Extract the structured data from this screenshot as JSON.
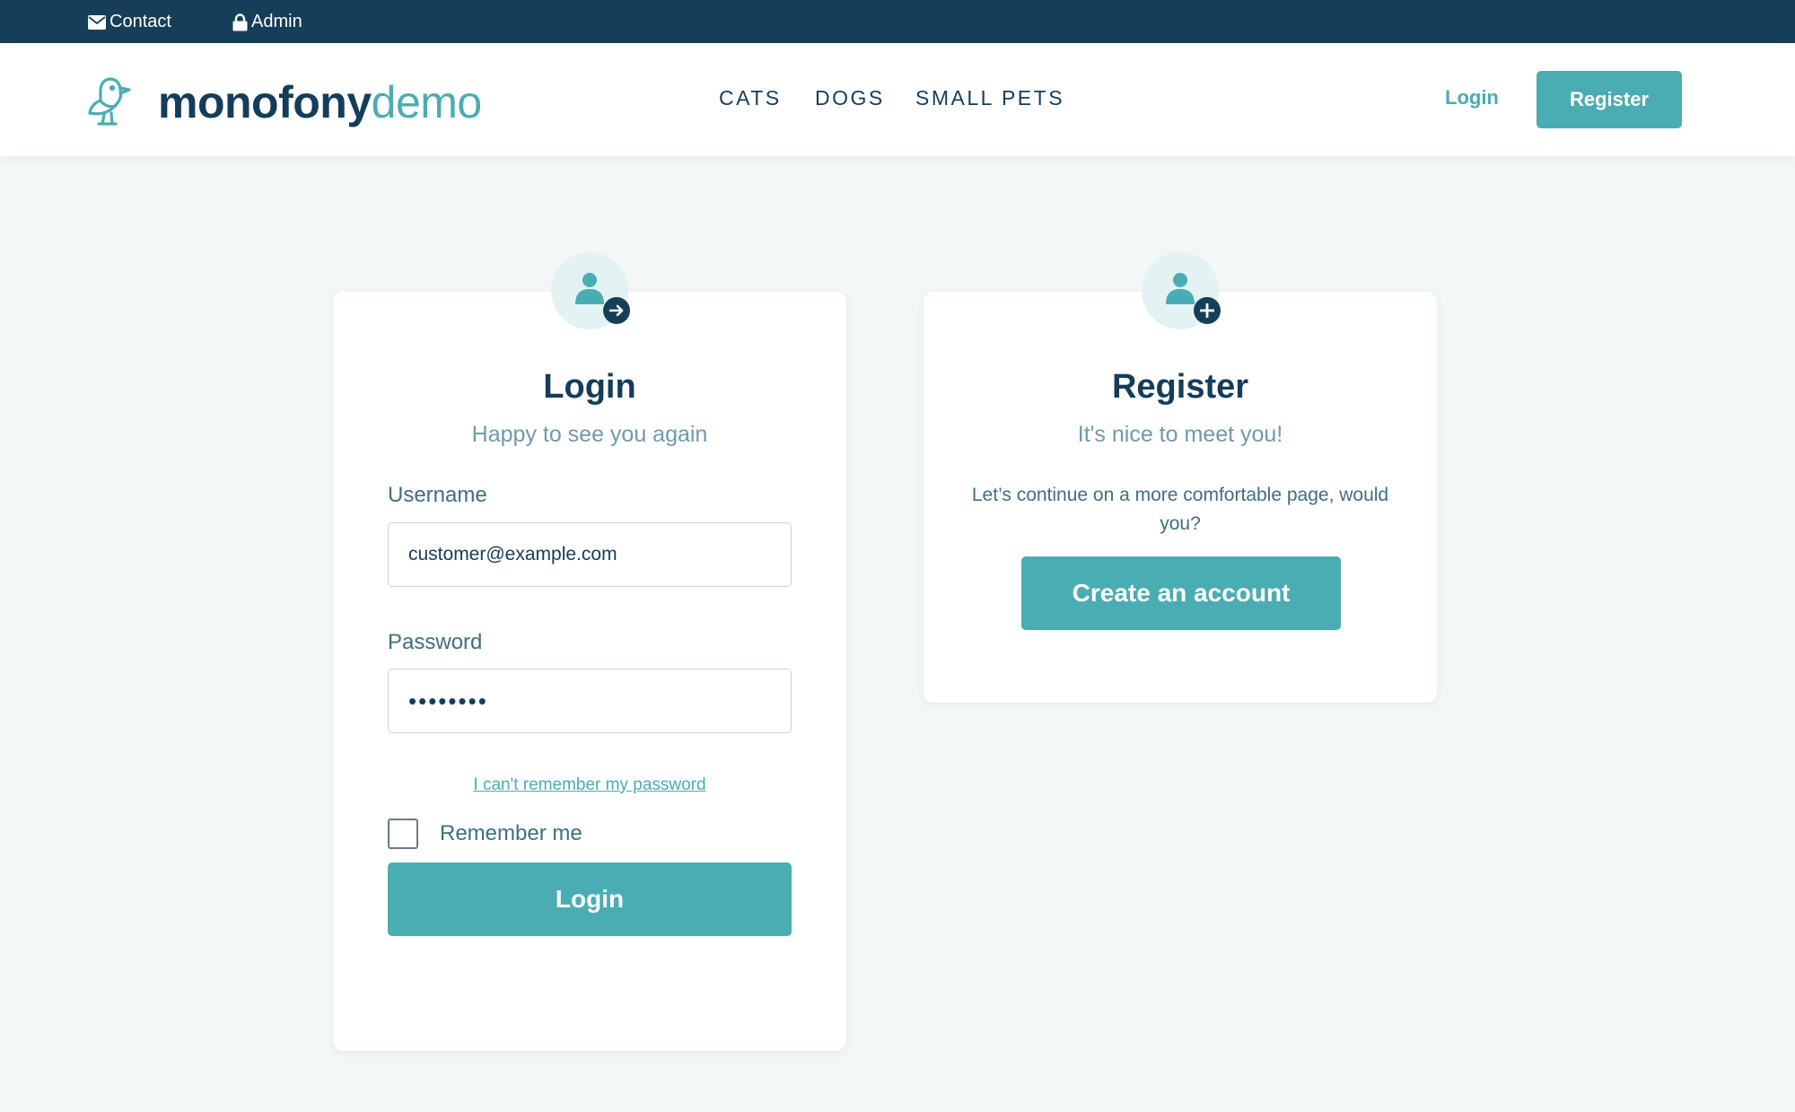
{
  "topbar": {
    "contact_label": "Contact",
    "admin_label": "Admin"
  },
  "header": {
    "logo_bold": "monofony",
    "logo_light": "demo",
    "nav": [
      "CATS",
      "DOGS",
      "SMALL PETS"
    ],
    "login_label": "Login",
    "register_label": "Register"
  },
  "login_card": {
    "title": "Login",
    "subtitle": "Happy to see you again",
    "username_label": "Username",
    "username_value": "customer@example.com",
    "password_label": "Password",
    "password_value": "password",
    "forgot_link": "I can't remember my password",
    "remember_label": "Remember me",
    "remember_checked": false,
    "submit_label": "Login"
  },
  "register_card": {
    "title": "Register",
    "subtitle": "It's nice to meet you!",
    "text": "Let’s continue on a more comfortable page, would you?",
    "button_label": "Create an account"
  },
  "colors": {
    "navy": "#163e58",
    "teal": "#4aadb3",
    "background": "#f3f7f7"
  },
  "icons": {
    "contact": "envelope-icon",
    "admin": "lock-icon",
    "logo": "bird-icon",
    "login_badge": "user-sign-in-icon",
    "register_badge": "user-add-icon"
  }
}
